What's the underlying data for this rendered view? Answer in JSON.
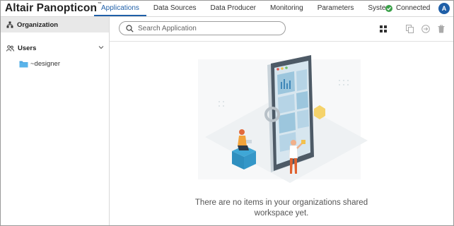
{
  "app": {
    "brand": "Altair Panopticon",
    "brand_mark": "™"
  },
  "nav": {
    "tabs": [
      {
        "label": "Applications",
        "active": true
      },
      {
        "label": "Data Sources",
        "active": false
      },
      {
        "label": "Data Producer",
        "active": false
      },
      {
        "label": "Monitoring",
        "active": false
      },
      {
        "label": "Parameters",
        "active": false
      },
      {
        "label": "System",
        "active": false
      }
    ]
  },
  "status": {
    "label": "Connected",
    "color": "#3ca14a"
  },
  "user": {
    "avatar_letter": "A",
    "avatar_color": "#1f5fa8"
  },
  "sidebar": {
    "organization_label": "Organization",
    "users_label": "Users",
    "folder_label": "~designer"
  },
  "toolbar": {
    "search_placeholder": "Search Application",
    "icons": [
      "grid-view-icon",
      "copy-icon",
      "move-icon",
      "delete-icon"
    ]
  },
  "main": {
    "empty_line1": "There are no items in your organizations shared",
    "empty_line2": "workspace yet."
  }
}
